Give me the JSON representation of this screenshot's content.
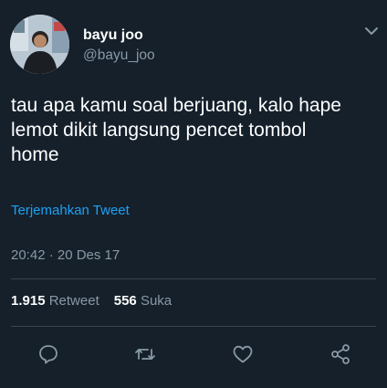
{
  "author": {
    "display_name": "bayu joo",
    "handle": "@bayu_joo"
  },
  "tweet": {
    "text": "tau apa kamu soal berjuang, kalo hape\nlemot dikit langsung pencet tombol\nhome",
    "translate_label": "Terjemahkan Tweet",
    "timestamp": "20:42 · 20 Des 17"
  },
  "stats": {
    "retweets_count": "1.915",
    "retweets_label": "Retweet",
    "likes_count": "556",
    "likes_label": "Suka"
  },
  "icons": {
    "menu": "chevron-down-icon",
    "reply": "reply-icon",
    "retweet": "retweet-icon",
    "like": "heart-icon",
    "share": "share-icon"
  },
  "colors": {
    "background": "#15202b",
    "accent": "#1da1f2",
    "secondary_text": "#8899a6",
    "divider": "#38444d"
  }
}
